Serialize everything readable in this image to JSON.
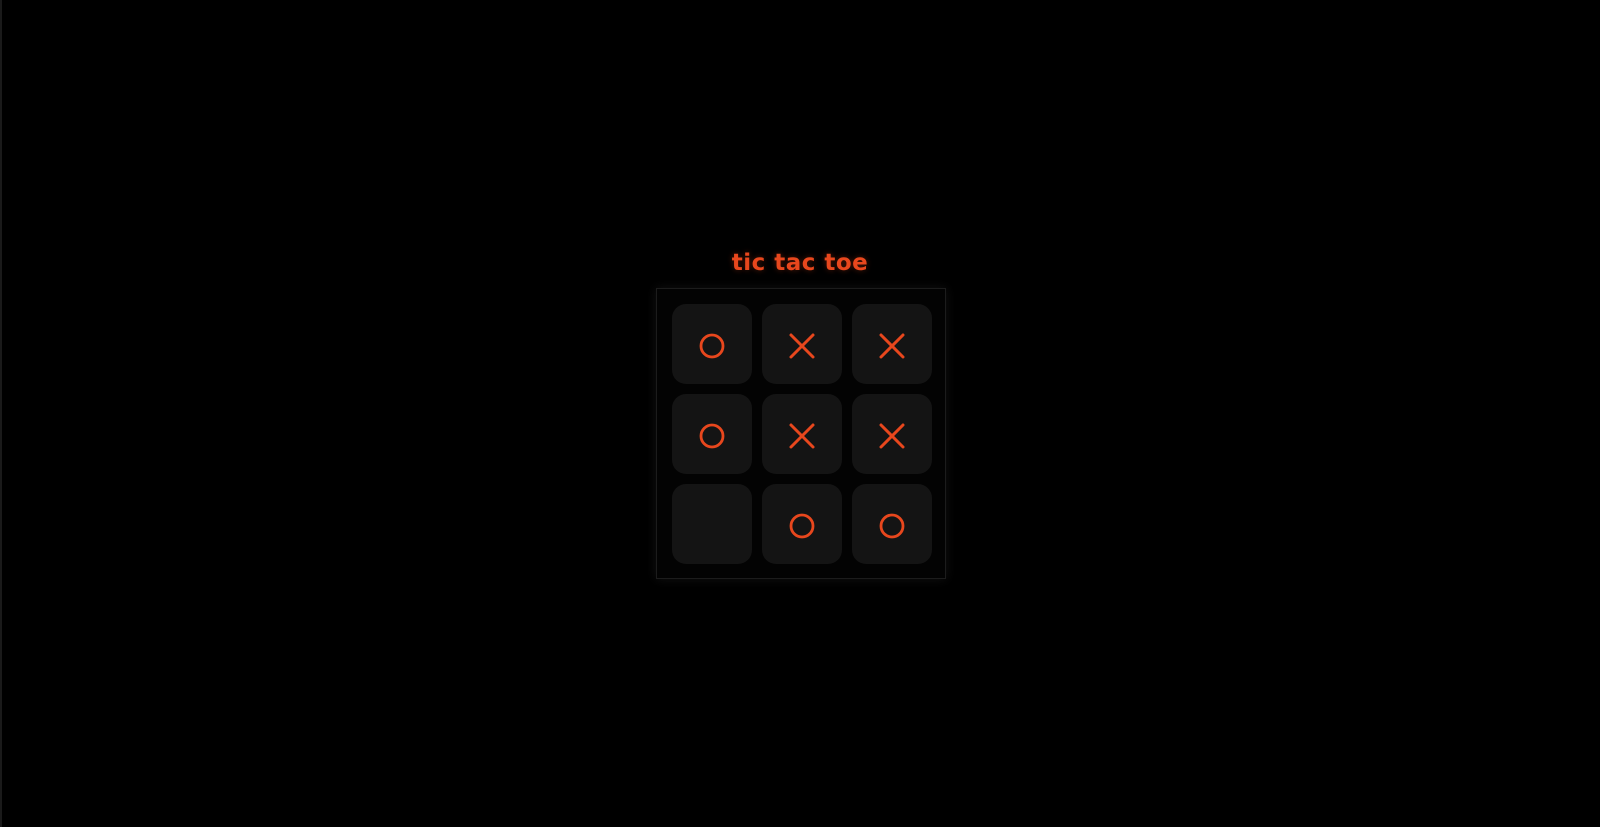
{
  "title": "tic tac toe",
  "colors": {
    "background": "#000000",
    "accent": "#e8471d",
    "cell": "#141414"
  },
  "board": {
    "rows": [
      [
        "O",
        "X",
        "X"
      ],
      [
        "O",
        "X",
        "X"
      ],
      [
        "",
        "O",
        "O"
      ]
    ]
  }
}
